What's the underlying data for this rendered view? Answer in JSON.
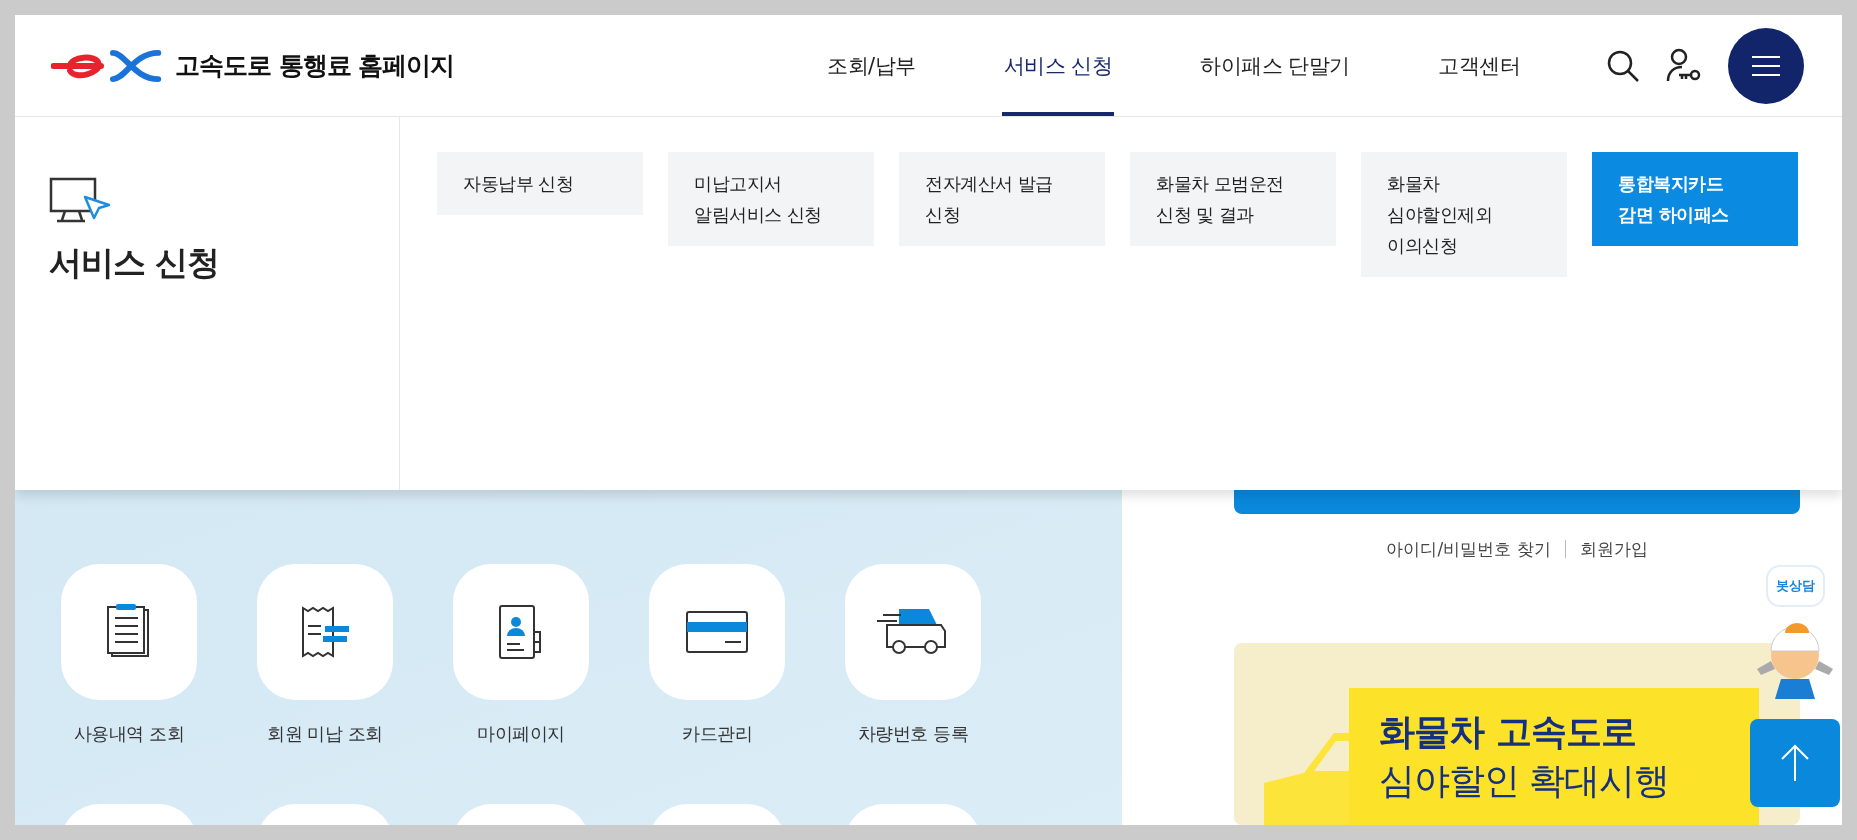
{
  "header": {
    "site_title": "고속도로 통행료 홈페이지",
    "nav": [
      {
        "label": "조회/납부",
        "selected": false
      },
      {
        "label": "서비스 신청",
        "selected": true
      },
      {
        "label": "하이패스 단말기",
        "selected": false
      },
      {
        "label": "고객센터",
        "selected": false
      }
    ]
  },
  "mega_menu": {
    "title": "서비스 신청",
    "items": [
      {
        "lines": [
          "자동납부 신청"
        ],
        "highlighted": false
      },
      {
        "lines": [
          "미납고지서",
          "알림서비스 신청"
        ],
        "highlighted": false
      },
      {
        "lines": [
          "전자계산서 발급",
          "신청"
        ],
        "highlighted": false
      },
      {
        "lines": [
          "화물차 모범운전",
          "신청 및 결과"
        ],
        "highlighted": false
      },
      {
        "lines": [
          "화물차",
          "심야할인제외",
          "이의신청"
        ],
        "highlighted": false
      },
      {
        "lines": [
          "통합복지카드",
          "감면 하이패스"
        ],
        "highlighted": true
      }
    ]
  },
  "services": [
    {
      "kind": "receipt-list",
      "label": "사용내역 조회"
    },
    {
      "kind": "bill",
      "label": "회원 미납 조회"
    },
    {
      "kind": "profile",
      "label": "마이페이지"
    },
    {
      "kind": "card",
      "label": "카드관리"
    },
    {
      "kind": "car",
      "label": "차량번호 등록"
    }
  ],
  "account_links": [
    "아이디/비밀번호 찾기",
    "회원가입"
  ],
  "banner": {
    "line_1": "화물차 고속도로",
    "line_2": "심야할인 확대시행"
  },
  "chatbot": {
    "bubble": "봇상담"
  }
}
